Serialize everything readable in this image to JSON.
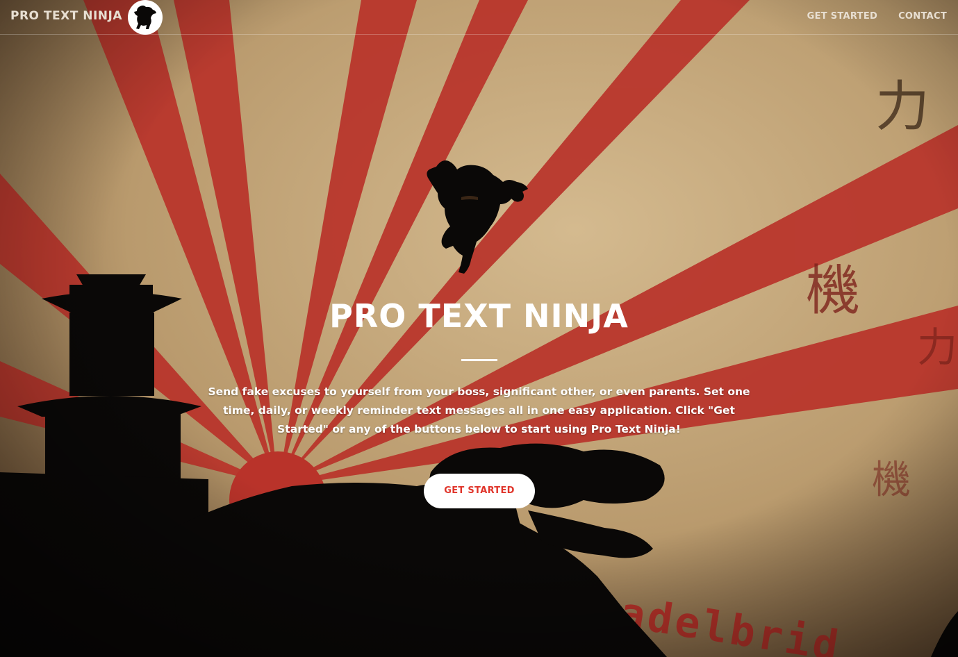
{
  "navbar": {
    "brand": "PRO TEXT NINJA",
    "links": [
      {
        "label": "GET STARTED"
      },
      {
        "label": "CONTACT"
      }
    ]
  },
  "hero": {
    "title": "PRO TEXT NINJA",
    "description": "Send fake excuses to yourself from your boss, significant other, or even parents. Set one time, daily, or weekly reminder text messages all in one easy application. Click \"Get Started\" or any of the buttons below to start using Pro Text Ninja!",
    "button_label": "GET STARTED"
  },
  "background": {
    "kanji": [
      "力",
      "機",
      "力",
      "機"
    ],
    "banner_text": "sadelbrid"
  },
  "colors": {
    "paper": "#c9ad82",
    "ray_red": "#b9332a",
    "silhouette": "#0a0807",
    "button_text": "#e0352b",
    "nav_text": "#e8dfd2"
  },
  "icons": {
    "brand_logo": "ninja-logo-icon",
    "hero_figure": "jumping-ninja-icon"
  }
}
